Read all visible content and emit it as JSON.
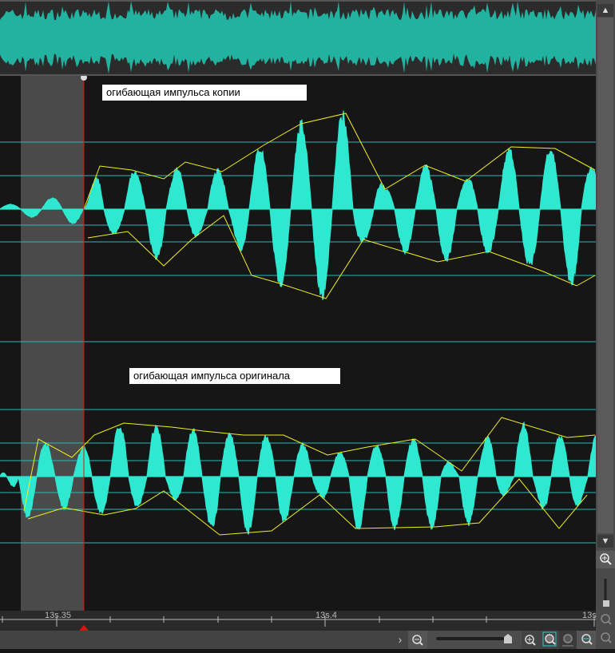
{
  "tracks": [
    {
      "label": "огибающая импульса копии"
    },
    {
      "label": "огибающая импульса оригинала"
    }
  ],
  "ruler": {
    "ticks": [
      "13s.35",
      "13s.4",
      "13s"
    ]
  },
  "colors": {
    "waveform": "#2ee8d0",
    "overview": "#22b3a0",
    "envelope": "#f0f020",
    "cursor": "#e01010",
    "gridline": "#2fb8b8",
    "selection": "#4a4a4a"
  },
  "icons": {
    "scroll_up": "▲",
    "scroll_down": "▼",
    "play_arrow": "›"
  }
}
